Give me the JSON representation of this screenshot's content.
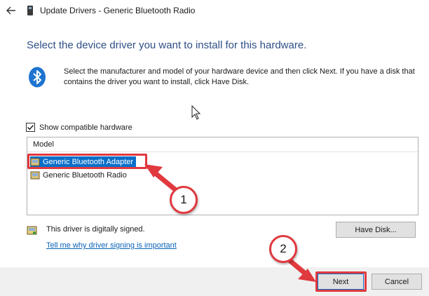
{
  "window": {
    "title": "Update Drivers - Generic Bluetooth Radio"
  },
  "heading": "Select the device driver you want to install for this hardware.",
  "instructions": "Select the manufacturer and model of your hardware device and then click Next. If you have a disk that contains the driver you want to install, click Have Disk.",
  "compatible": {
    "label": "Show compatible hardware",
    "checked": true
  },
  "model_list": {
    "header": "Model",
    "items": [
      {
        "label": "Generic Bluetooth Adapter",
        "selected": true
      },
      {
        "label": "Generic Bluetooth Radio",
        "selected": false
      }
    ]
  },
  "signing": {
    "status": "This driver is digitally signed.",
    "link": "Tell me why driver signing is important"
  },
  "buttons": {
    "have_disk": "Have Disk...",
    "next": "Next",
    "cancel": "Cancel"
  },
  "annotations": {
    "step_1": "1",
    "step_2": "2"
  },
  "colors": {
    "accent": "#0a6fc9",
    "annotation": "#e0393e",
    "heading": "#2f4f86",
    "link": "#0a61b8"
  }
}
